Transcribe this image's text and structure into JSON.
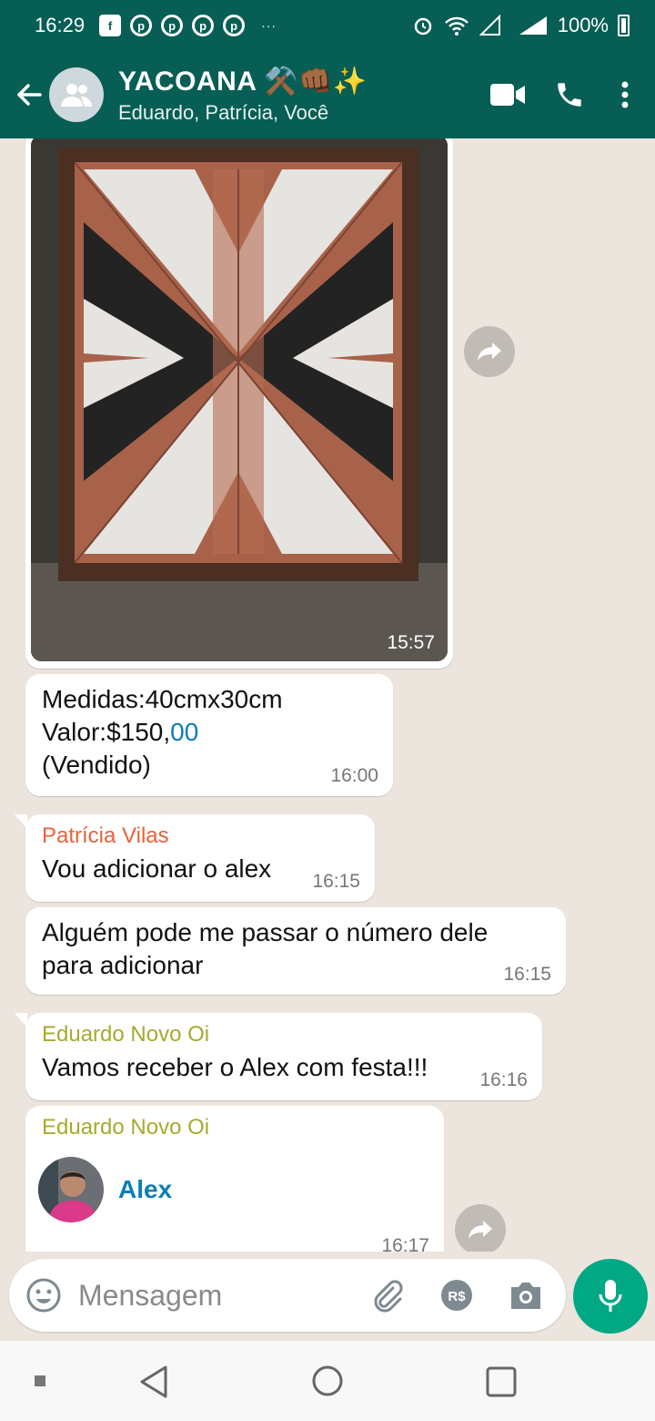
{
  "status_bar": {
    "time": "16:29",
    "more_indicator": "···",
    "battery": "100%",
    "icons": [
      "facebook-icon",
      "pinterest-icon",
      "alarm-icon",
      "wifi-icon",
      "signal-icon",
      "battery-icon"
    ]
  },
  "header": {
    "title": "YACOANA ⚒️👊🏾✨",
    "subtitle": "Eduardo, Patrícia, Você",
    "bg_color": "#075e54"
  },
  "messages": {
    "image_msg": {
      "time": "15:57"
    },
    "info_msg": {
      "line1": "Medidas:40cmx30cm",
      "line2_prefix": "Valor:$150,",
      "line2_link": "00",
      "line3": "(Vendido)",
      "time": "16:00"
    },
    "patricia_msg": {
      "sender": "Patrícia Vilas",
      "sender_color": "#e8623a",
      "text": "Vou adicionar o alex",
      "time": "16:15"
    },
    "patricia_msg2": {
      "line1": "Alguém pode me passar o número dele",
      "line2": "para adicionar",
      "time": "16:15"
    },
    "eduardo_msg": {
      "sender": "Eduardo Novo Oi",
      "sender_color": "#a7aa2e",
      "text": "Vamos receber o Alex com festa!!!",
      "time": "16:16"
    },
    "eduardo_contact": {
      "sender": "Eduardo Novo Oi",
      "contact_name": "Alex",
      "time": "16:17"
    }
  },
  "input": {
    "placeholder": "Mensagem"
  }
}
